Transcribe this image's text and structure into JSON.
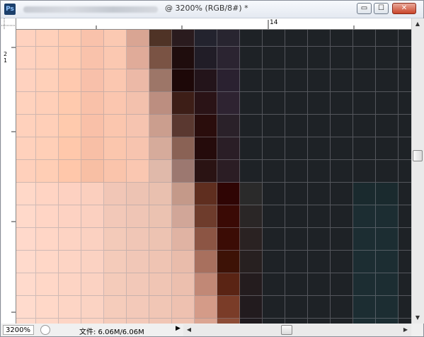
{
  "window": {
    "title_suffix": "@ 3200% (RGB/8#) *",
    "icon_label": "Ps",
    "minimize_label": "▭",
    "maximize_label": "☐",
    "close_label": "✕"
  },
  "rulers": {
    "top_label": "14",
    "left_labels": [
      "2",
      "1"
    ]
  },
  "status": {
    "zoom_value": "3200%",
    "doc_info": "文件: 6.06M/6.06M"
  },
  "canvas": {
    "pixel_colors": [
      [
        "#ffd2bf",
        "#ffd0ba",
        "#ffcbb1",
        "#f9c2ab",
        "#fbc9b2",
        "#d9a593",
        "#4f3326",
        "#2a1b1e",
        "#23232e",
        "#282530",
        "#1e2226",
        "#1e2226",
        "#1e2226",
        "#1e2226",
        "#1e2226",
        "#1e2226",
        "#1e2226",
        "#1e2226"
      ],
      [
        "#ffd2bf",
        "#ffd0ba",
        "#ffcbb1",
        "#f9c2ab",
        "#fbc8b1",
        "#e0ab99",
        "#7a5344",
        "#1f0d0d",
        "#211d27",
        "#2b2431",
        "#1e2226",
        "#1e2226",
        "#1e2226",
        "#1e2226",
        "#1e2226",
        "#1e2226",
        "#1e2226",
        "#1e2226"
      ],
      [
        "#ffd2bf",
        "#ffd0b9",
        "#ffc9af",
        "#f8c0aa",
        "#fbc7b0",
        "#ecb9a7",
        "#9d7668",
        "#1d0808",
        "#23141a",
        "#2a2130",
        "#1e2226",
        "#1e2226",
        "#1e2226",
        "#1e2226",
        "#1e2226",
        "#1e2226",
        "#1e2226",
        "#1e2226"
      ],
      [
        "#ffd2bd",
        "#ffcfb8",
        "#ffcaae",
        "#f9c1a9",
        "#fbc6af",
        "#f3c1ad",
        "#bc8e80",
        "#3d1e17",
        "#2a1316",
        "#2e2331",
        "#1e2226",
        "#1e2226",
        "#1e2226",
        "#1e2226",
        "#1e2226",
        "#1e2226",
        "#1e2226",
        "#1e2226"
      ],
      [
        "#ffd1bc",
        "#ffcfb8",
        "#ffcaad",
        "#f9c0a8",
        "#fbc6ae",
        "#f6c4b0",
        "#cb9e8e",
        "#5a3830",
        "#2a0d0c",
        "#2a2129",
        "#1e2226",
        "#1e2226",
        "#1e2226",
        "#1e2226",
        "#1e2226",
        "#1e2226",
        "#1e2226",
        "#1e2226"
      ],
      [
        "#ffd1bc",
        "#ffcfb7",
        "#ffc8ab",
        "#f8bfa6",
        "#fbc6ad",
        "#f7c4af",
        "#d6ab9b",
        "#8a6255",
        "#250b0b",
        "#2a1e26",
        "#1e2226",
        "#1e2226",
        "#1e2226",
        "#1e2226",
        "#1e2226",
        "#1e2226",
        "#1e2226",
        "#1e2226"
      ],
      [
        "#ffd0bb",
        "#ffceb5",
        "#ffc7aa",
        "#f8bfa4",
        "#fac4ab",
        "#fac7b1",
        "#e0b9aa",
        "#9c7870",
        "#2a1313",
        "#2b1d24",
        "#1e2226",
        "#1e2226",
        "#1e2226",
        "#1e2226",
        "#1e2226",
        "#1e2226",
        "#1e2226",
        "#1e2226"
      ],
      [
        "#ffd8c8",
        "#ffd4c3",
        "#fdd1c1",
        "#fbcfbe",
        "#f1c6b6",
        "#edc3b3",
        "#e9c0af",
        "#c49989",
        "#5f2e1f",
        "#2f0504",
        "#2a2a2a",
        "#1e2226",
        "#1e2226",
        "#1e2226",
        "#1e2226",
        "#1a2a2e",
        "#1a2a2e",
        "#1e2226"
      ],
      [
        "#ffd9ca",
        "#ffd5c5",
        "#fdd2c2",
        "#fbd0c0",
        "#f2c8b8",
        "#efc5b5",
        "#ebc2b1",
        "#d1a698",
        "#6e3c2c",
        "#3a0a05",
        "#2a2626",
        "#1e2226",
        "#1e2226",
        "#1e2226",
        "#1e2226",
        "#1c2d32",
        "#1c2d32",
        "#1e2226"
      ],
      [
        "#ffd9cb",
        "#ffd6c6",
        "#fdd3c3",
        "#fbd1c1",
        "#f3cab9",
        "#f0c6b6",
        "#edc3b2",
        "#e0b3a3",
        "#8c5544",
        "#3b0c05",
        "#2a2222",
        "#1e2226",
        "#1e2226",
        "#1e2226",
        "#1e2226",
        "#1c2d32",
        "#1c2d32",
        "#1e2226"
      ],
      [
        "#ffdacc",
        "#ffd7c7",
        "#fdd4c4",
        "#fbd2c2",
        "#f4cbba",
        "#f1c7b7",
        "#efc4b3",
        "#e9bcab",
        "#a8705e",
        "#3d1206",
        "#272020",
        "#1e2226",
        "#1e2226",
        "#1e2226",
        "#1e2226",
        "#1c2d32",
        "#1c2d32",
        "#1e2226"
      ],
      [
        "#ffdacc",
        "#ffd7c7",
        "#fdd4c4",
        "#fbd2c2",
        "#f4cbba",
        "#f2c8b8",
        "#f0c5b4",
        "#ecbfae",
        "#c18876",
        "#5a2414",
        "#241c1e",
        "#1e2226",
        "#1e2226",
        "#1e2226",
        "#1e2226",
        "#1c2d32",
        "#1c2d32",
        "#1e2226"
      ],
      [
        "#ffdbcd",
        "#ffd8c8",
        "#fdd5c5",
        "#fbd3c3",
        "#f5ccbb",
        "#f3c9b9",
        "#f1c6b5",
        "#eec1b0",
        "#d49b88",
        "#7a3c28",
        "#221b1e",
        "#1e2226",
        "#1e2226",
        "#1e2226",
        "#1e2226",
        "#1c2d32",
        "#1c2d32",
        "#1e2226"
      ],
      [
        "#ffdbcd",
        "#ffd8c8",
        "#fdd5c5",
        "#fbd3c3",
        "#f5ccbb",
        "#f3c9b9",
        "#f1c6b5",
        "#efc3b2",
        "#dba592",
        "#8c4c36",
        "#1f1a1e",
        "#1e2226",
        "#1e2226",
        "#1e2226",
        "#1e2226",
        "#1c2d32",
        "#1c2d32",
        "#1e2226"
      ]
    ]
  }
}
